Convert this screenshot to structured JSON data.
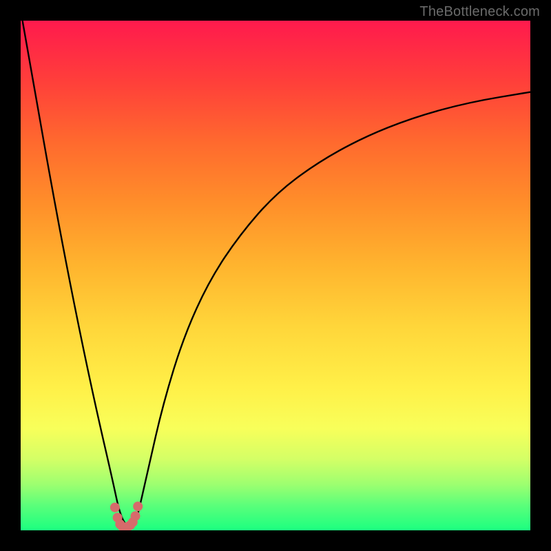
{
  "attribution": "TheBottleneck.com",
  "chart_data": {
    "type": "line",
    "title": "",
    "xlabel": "",
    "ylabel": "",
    "xlim": [
      0,
      100
    ],
    "ylim": [
      0,
      100
    ],
    "background_gradient": "green at 0 to red at 100 (bottleneck severity)",
    "series": [
      {
        "name": "bottleneck-curve",
        "x": [
          0,
          3,
          6,
          9,
          12,
          15,
          18,
          19.5,
          21,
          22,
          23,
          25,
          28,
          32,
          37,
          43,
          50,
          58,
          67,
          77,
          88,
          100
        ],
        "y": [
          102,
          85,
          68,
          52,
          37,
          23,
          10,
          3,
          0.5,
          0.5,
          3,
          12,
          25,
          38,
          49,
          58,
          66,
          72,
          77,
          81,
          84,
          86
        ]
      },
      {
        "name": "minimum-marker",
        "x": [
          18.5,
          19,
          19.5,
          20,
          20.5,
          21,
          21.5,
          22,
          22.5,
          23
        ],
        "y": [
          4.5,
          2.5,
          1.2,
          0.7,
          0.6,
          0.7,
          1.0,
          1.6,
          2.8,
          4.7
        ]
      }
    ],
    "marker_style": {
      "color": "#d66b6b",
      "radius_px": 7
    },
    "minimum": {
      "x": 20.5,
      "y": 0.6
    }
  }
}
